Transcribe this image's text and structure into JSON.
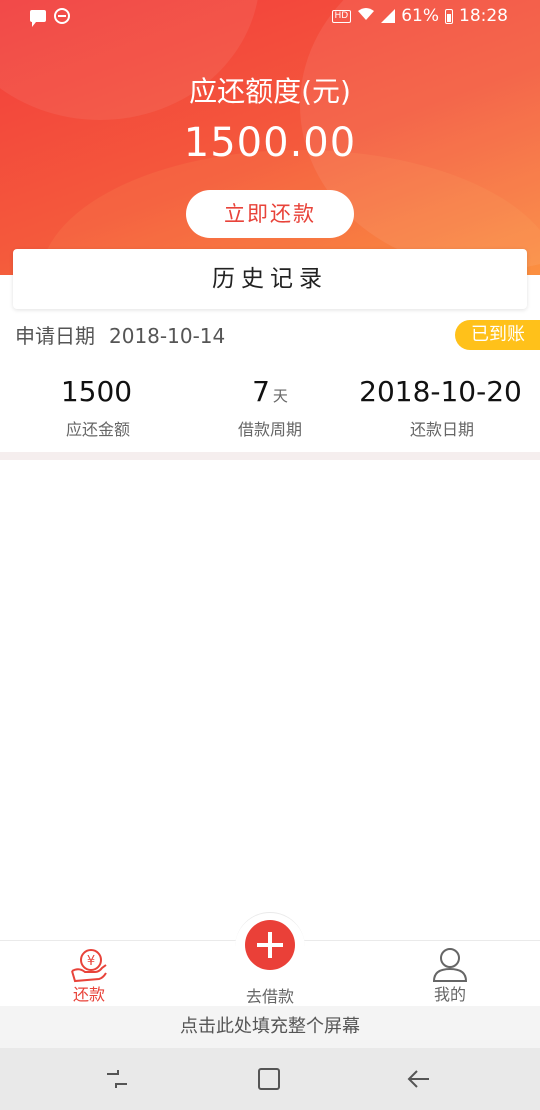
{
  "status_bar": {
    "battery": "61%",
    "time": "18:28",
    "hd_badge": "HD"
  },
  "header": {
    "title": "应还额度(元)",
    "amount": "1500.00",
    "repay_button": "立即还款"
  },
  "history": {
    "title": "历史记录"
  },
  "record": {
    "apply_label": "申请日期",
    "apply_date": "2018-10-14",
    "status_badge": "已到账",
    "stats": [
      {
        "value": "1500",
        "unit": "",
        "label": "应还金额"
      },
      {
        "value": "7",
        "unit": "天",
        "label": "借款周期"
      },
      {
        "value": "2018-10-20",
        "unit": "",
        "label": "还款日期"
      }
    ]
  },
  "bottom_nav": {
    "items": [
      {
        "label": "还款",
        "icon": "hand-coin-icon",
        "active": true
      },
      {
        "label": "去借款",
        "icon": "plus-icon",
        "active": false
      },
      {
        "label": "我的",
        "icon": "person-icon",
        "active": false
      }
    ]
  },
  "fill_hint": "点击此处填充整个屏幕",
  "colors": {
    "accent": "#e8433a",
    "badge": "#ffc11a",
    "header_start": "#f23c3c",
    "header_end": "#fb8a3c"
  }
}
